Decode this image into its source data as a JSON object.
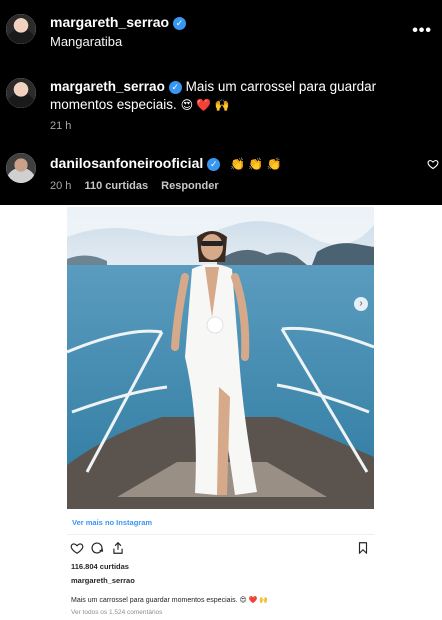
{
  "post_header": {
    "username": "margareth_serrao",
    "location": "Mangaratiba",
    "more_label": "•••"
  },
  "caption_comment": {
    "username": "margareth_serrao",
    "text": "Mais um carrossel para guardar momentos especiais.",
    "emojis": "😍 ❤️ 🙌",
    "time": "21 h"
  },
  "reply_comment": {
    "username": "danilosanfoneirooficial",
    "emojis": "👏 👏 👏",
    "time": "20 h",
    "likes": "110 curtidas",
    "reply_label": "Responder"
  },
  "embed": {
    "view_more": "Ver mais no Instagram",
    "likes": "116.804 curtidas",
    "owner": "margareth_serrao",
    "caption": "Mais um carrossel para guardar momentos especiais.",
    "caption_emojis": "😍 ❤️ 🙌",
    "comments_link": "Ver todos os 1.524 comentários"
  },
  "colors": {
    "verified": "#3897f0",
    "link": "#3897f0",
    "sea": "#4f8fb0"
  },
  "icons": [
    "more-icon",
    "verified-icon",
    "heart-icon",
    "comment-icon",
    "share-icon",
    "bookmark-icon",
    "next-arrow-icon"
  ]
}
